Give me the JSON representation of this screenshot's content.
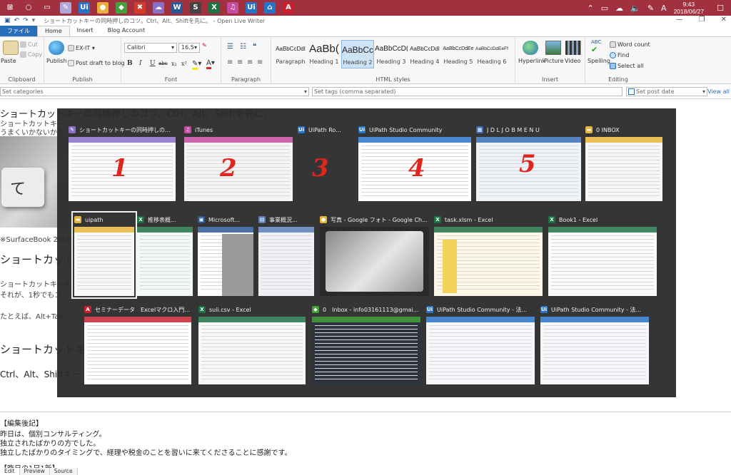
{
  "taskbar": {
    "icons": [
      {
        "name": "windows-start-icon",
        "color": "#a2313f",
        "glyph": "⊞"
      },
      {
        "name": "cortana-icon",
        "color": "#a2313f",
        "glyph": "○"
      },
      {
        "name": "task-view-icon",
        "color": "#a2313f",
        "glyph": "▭"
      },
      {
        "name": "live-writer-taskbar-icon",
        "color": "#b0a6d8",
        "glyph": "✎"
      },
      {
        "name": "uipath-taskbar-icon",
        "color": "#2773c6",
        "glyph": "Ui"
      },
      {
        "name": "chrome-taskbar-icon",
        "color": "#e8b03a",
        "glyph": "●"
      },
      {
        "name": "evernote-taskbar-icon",
        "color": "#44a13c",
        "glyph": "◆"
      },
      {
        "name": "xmind-taskbar-icon",
        "color": "#d33b2c",
        "glyph": "✖"
      },
      {
        "name": "cloud-app-taskbar-icon",
        "color": "#8b6fc6",
        "glyph": "☁"
      },
      {
        "name": "word-taskbar-icon",
        "color": "#2b5797",
        "glyph": "W"
      },
      {
        "name": "s-app-taskbar-icon",
        "color": "#444444",
        "glyph": "S"
      },
      {
        "name": "excel-taskbar-icon",
        "color": "#1e7145",
        "glyph": "X"
      },
      {
        "name": "itunes-taskbar-icon",
        "color": "#c54c9f",
        "glyph": "♫"
      },
      {
        "name": "uipath-studio-taskbar-icon",
        "color": "#2773c6",
        "glyph": "Ui"
      },
      {
        "name": "robot-taskbar-icon",
        "color": "#2773c6",
        "glyph": "⌂"
      },
      {
        "name": "acrobat-taskbar-icon",
        "color": "#c8202f",
        "glyph": "A"
      }
    ],
    "system": {
      "tray_up": "⌃",
      "battery": "▭",
      "network": "☁",
      "volume": "🔈",
      "pen": "✎",
      "ime": "A",
      "notifications": "☐"
    },
    "time": "9:43",
    "date": "2018/06/27"
  },
  "window": {
    "title": "ショートカットキーの同時押しのコツ。Ctrl、Alt、Shiftを先に。 - Open Live Writer",
    "minimize": "—",
    "maximize": "❐",
    "close": "✕"
  },
  "ribbon_tabs": [
    "ファイル",
    "Home",
    "Insert",
    "Blog Account"
  ],
  "ribbon": {
    "clipboard": {
      "paste": "Paste",
      "cut": "Cut",
      "copy": "Copy",
      "label": "Clipboard"
    },
    "publish": {
      "publish": "Publish",
      "extit": "EX-IT",
      "draft": "Post draft to blog",
      "label": "Publish"
    },
    "font": {
      "family": "Calibri",
      "size": "16.5",
      "bold": "B",
      "italic": "I",
      "underline": "U",
      "strike": "abc",
      "sub": "x₂",
      "sup": "x²",
      "label": "Font"
    },
    "paragraph": {
      "label": "Paragraph"
    },
    "styles": {
      "items": [
        {
          "preview": "AaBbCcDdI",
          "name": "Paragraph"
        },
        {
          "preview": "AaBb(",
          "name": "Heading 1"
        },
        {
          "preview": "AaBbCc",
          "name": "Heading 2"
        },
        {
          "preview": "AaBbCcD(",
          "name": "Heading 3"
        },
        {
          "preview": "AaBbCcDdI",
          "name": "Heading 4"
        },
        {
          "preview": "AaBbCcDdEe",
          "name": "Heading 5"
        },
        {
          "preview": "AaBbCcDdEeFfG",
          "name": "Heading 6"
        }
      ],
      "label": "HTML styles"
    },
    "insert": {
      "hyperlink": "Hyperlink",
      "picture": "Picture",
      "video": "Video",
      "label": "Insert"
    },
    "editing": {
      "spelling": "Spelling",
      "word_count": "Word count",
      "find": "Find",
      "select_all": "Select all",
      "label": "Editing"
    }
  },
  "tagbar": {
    "categories": "Set categories",
    "tags": "Set tags (comma separated)",
    "post_date": "Set post date",
    "view_all": "View all"
  },
  "editor": {
    "heading1": "ショートカットキーの同時押しのコツ。Ctrl、Alt、Shiftを先に。",
    "line1": "ショートカットキー",
    "line2": "うまくいかないかた",
    "caption": "※SurfaceBook 2のキーボ",
    "heading2": "ショートカット",
    "para1": "ショートカットキーを使",
    "para2": "それが、1秒でもコンマ",
    "para3": "たとえば、Alt+Tab",
    "heading3": "ショートカットキー",
    "heading4": "Ctrl、Alt、Shiftキー",
    "photo_glyph": "て",
    "postscript_title": "【編集後記】",
    "postscript_1": "昨日は、個別コンサルティング。",
    "postscript_2": "独立されたばかりの方でした。",
    "postscript_3": "独立したばかりのタイミングで、経理や税金のことを習いに来てくださることに感謝です。",
    "daily_new": "【昨日の1日1新】"
  },
  "bottom_tabs": [
    "Edit",
    "Preview",
    "Source"
  ],
  "switcher": {
    "windows": [
      {
        "title": "ショートカットキーの同時押しのコツ。",
        "icon": "live-writer-icon",
        "icon_color": "#8b6fc6",
        "glyph": "✎",
        "num": "1"
      },
      {
        "title": "iTunes",
        "icon": "itunes-icon",
        "icon_color": "#c54c9f",
        "glyph": "♫",
        "num": "2"
      },
      {
        "title": "UiPath Ro...",
        "icon": "uipath-robot-icon",
        "icon_color": "#2773c6",
        "glyph": "Ui",
        "num": "3"
      },
      {
        "title": "UiPath Studio Community",
        "icon": "uipath-studio-icon",
        "icon_color": "#2773c6",
        "glyph": "Ui",
        "num": "4"
      },
      {
        "title": "J D L   J O B   M E N U",
        "icon": "jdl-icon",
        "icon_color": "#3a6fb5",
        "glyph": "▦",
        "num": "5"
      },
      {
        "title": "0 INBOX",
        "icon": "folder-icon",
        "icon_color": "#e6b53a",
        "glyph": "▬",
        "num": ""
      },
      {
        "title": "uipath",
        "icon": "folder-icon",
        "icon_color": "#e6b53a",
        "glyph": "▬",
        "num": ""
      },
      {
        "title": "推移表概...",
        "icon": "excel-icon",
        "icon_color": "#1e7145",
        "glyph": "X",
        "num": ""
      },
      {
        "title": "Microsoft...",
        "icon": "edge-icon",
        "icon_color": "#2b5797",
        "glyph": "▣",
        "num": ""
      },
      {
        "title": "事業概況...",
        "icon": "document-icon",
        "icon_color": "#5a7fb5",
        "glyph": "▤",
        "num": ""
      },
      {
        "title": "写真 - Google フォト - Google Ch...",
        "icon": "chrome-icon",
        "icon_color": "#e8b03a",
        "glyph": "●",
        "num": ""
      },
      {
        "title": "task.xlsm - Excel",
        "icon": "excel-icon",
        "icon_color": "#1e7145",
        "glyph": "X",
        "num": ""
      },
      {
        "title": "Book1 - Excel",
        "icon": "excel-icon",
        "icon_color": "#1e7145",
        "glyph": "X",
        "num": ""
      },
      {
        "title": "セミナーデータ　Excelマクロ入門　レ...",
        "icon": "acrobat-icon",
        "icon_color": "#c8202f",
        "glyph": "A",
        "num": ""
      },
      {
        "title": "suii.csv - Excel",
        "icon": "excel-icon",
        "icon_color": "#1e7145",
        "glyph": "X",
        "num": ""
      },
      {
        "title": "0　Inbox - info03161113@gmai...",
        "icon": "evernote-icon",
        "icon_color": "#44a13c",
        "glyph": "◆",
        "num": ""
      },
      {
        "title": "UiPath Studio Community - 法...",
        "icon": "uipath-studio-icon",
        "icon_color": "#2773c6",
        "glyph": "Ui",
        "num": ""
      },
      {
        "title": "UiPath Studio Community - 法...",
        "icon": "uipath-studio-icon",
        "icon_color": "#2773c6",
        "glyph": "Ui",
        "num": ""
      }
    ]
  },
  "colors": {
    "taskbar": "#a2313f",
    "file_tab": "#2a6ebb",
    "annotation_red": "#e0261c"
  }
}
